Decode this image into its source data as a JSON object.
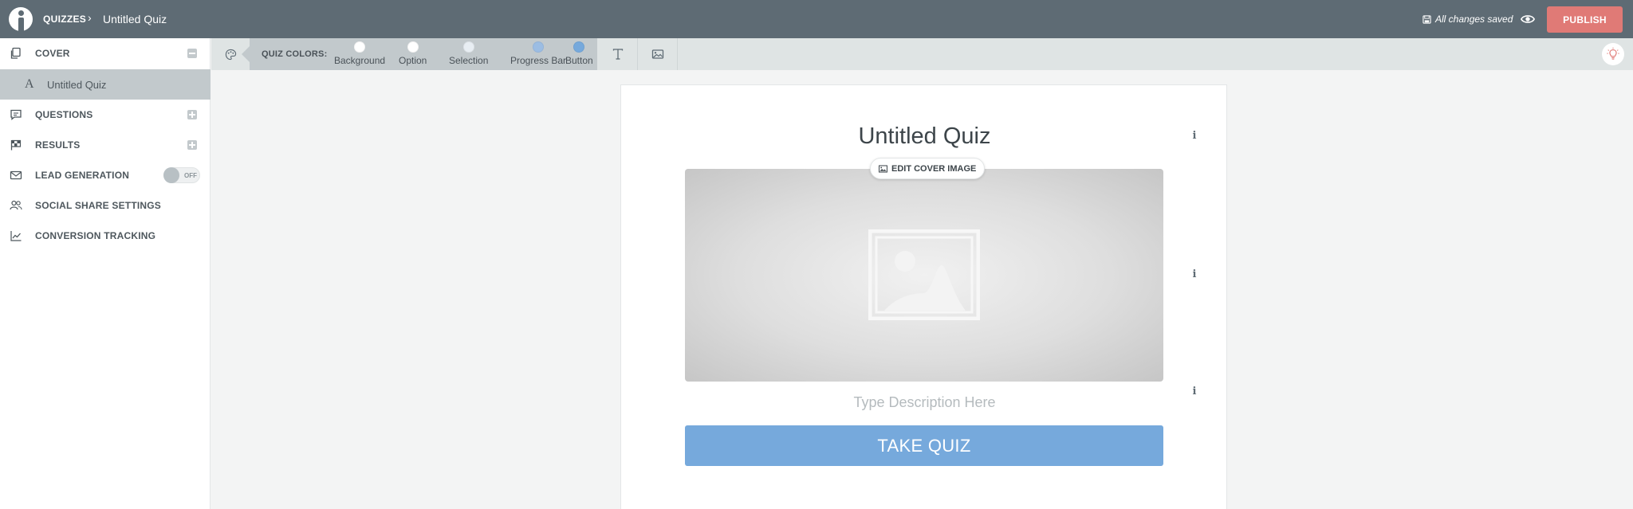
{
  "topbar": {
    "breadcrumb_root": "QUIZZES",
    "breadcrumb_separator": "›",
    "breadcrumb_current": "Untitled Quiz",
    "save_status": "All changes saved",
    "publish_label": "PUBLISH"
  },
  "sidebar": {
    "cover_label": "COVER",
    "cover_sub_icon": "A",
    "cover_sub_label": "Untitled Quiz",
    "questions_label": "QUESTIONS",
    "results_label": "RESULTS",
    "lead_generation_label": "LEAD GENERATION",
    "lead_generation_toggle": "OFF",
    "social_share_label": "SOCIAL SHARE SETTINGS",
    "conversion_tracking_label": "CONVERSION TRACKING"
  },
  "toolbar": {
    "quiz_colors_label": "QUIZ COLORS:",
    "swatches": [
      {
        "name": "Background",
        "color": "#ffffff"
      },
      {
        "name": "Option",
        "color": "#ffffff"
      },
      {
        "name": "Selection",
        "color": "#e8eef3"
      },
      {
        "name": "Progress Bar",
        "color": "#9cbde3"
      },
      {
        "name": "Button",
        "color": "#76a9dc"
      }
    ]
  },
  "canvas": {
    "title": "Untitled Quiz",
    "edit_cover_label": "EDIT COVER IMAGE",
    "description_placeholder": "Type Description Here",
    "take_quiz_label": "TAKE QUIZ",
    "info_glyph": "i"
  },
  "colors": {
    "topbar": "#5e6b74",
    "publish": "#e07a76",
    "accent_button": "#76a9dc",
    "sidebar_selected": "#c2c9cc"
  }
}
